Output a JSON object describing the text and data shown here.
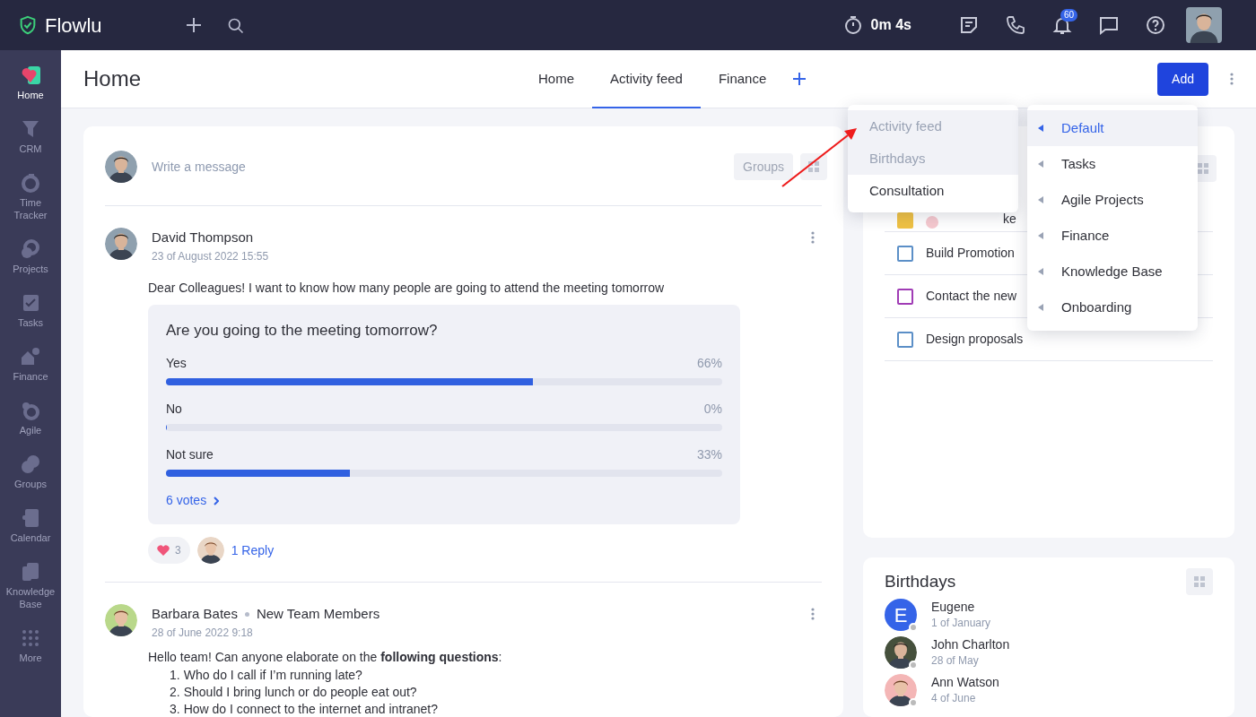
{
  "topbar": {
    "logo": "Flowlu",
    "timer": "0m 4s",
    "notifications_badge": "60"
  },
  "sidebar": {
    "items": [
      {
        "label": "Home",
        "selected": true
      },
      {
        "label": "CRM",
        "selected": false
      },
      {
        "label": "Time Tracker",
        "selected": false
      },
      {
        "label": "Projects",
        "selected": false
      },
      {
        "label": "Tasks",
        "selected": false
      },
      {
        "label": "Finance",
        "selected": false
      },
      {
        "label": "Agile",
        "selected": false
      },
      {
        "label": "Groups",
        "selected": false
      },
      {
        "label": "Calendar",
        "selected": false
      },
      {
        "label": "Knowledge Base",
        "selected": false
      },
      {
        "label": "More",
        "selected": false
      }
    ]
  },
  "header": {
    "title": "Home",
    "tabs": [
      {
        "label": "Home",
        "selected": false
      },
      {
        "label": "Activity feed",
        "selected": true
      },
      {
        "label": "Finance",
        "selected": false
      }
    ],
    "add_button": "Add"
  },
  "composer": {
    "placeholder": "Write a message",
    "groups_button": "Groups"
  },
  "posts": [
    {
      "author": "David Thompson",
      "date": "23 of August 2022 15:55",
      "text": "Dear Colleagues! I want to know how many people are going to attend the meeting tomorrow",
      "poll": {
        "question": "Are you going to the meeting tomorrow?",
        "options": [
          {
            "label": "Yes",
            "percent": "66%",
            "level": 0.66
          },
          {
            "label": "No",
            "percent": "0%",
            "level": 0
          },
          {
            "label": "Not sure",
            "percent": "33%",
            "level": 0.33
          }
        ],
        "votes": "6 votes"
      },
      "likes": "3",
      "replies": "1 Reply"
    },
    {
      "author": "Barbara Bates",
      "group": "New Team Members",
      "date": "28 of June 2022 9:18",
      "text": "Hello team! Can anyone elaborate on the **following questions**:",
      "list": [
        {
          "marker": "1.",
          "text": "Who do I call if I’m running late?"
        },
        {
          "marker": "2.",
          "text": "Should I bring lunch or do people eat out?"
        },
        {
          "marker": "3.",
          "text": "How do I connect to the internet and intranet?"
        }
      ]
    }
  ],
  "tasks": {
    "items": [
      {
        "text": "ke",
        "color": "#f0c244"
      },
      {
        "text": "Build Promotion",
        "color": "#5b8fc7"
      },
      {
        "text": "Contact the new",
        "color": "#a03cb5"
      },
      {
        "text": "Design proposals",
        "color": "#5b8fc7"
      }
    ]
  },
  "birthdays": {
    "title": "Birthdays",
    "people": [
      {
        "name": "Eugene",
        "date": "1 of January",
        "kind": "letter",
        "initial": "E"
      },
      {
        "name": "John Charlton",
        "date": "28 of May",
        "kind": "photo"
      },
      {
        "name": "Ann Watson",
        "date": "4 of June",
        "kind": "photo"
      }
    ]
  },
  "widget_menu": {
    "items": [
      {
        "label": "Activity feed",
        "disabled": true
      },
      {
        "label": "Birthdays",
        "disabled": true
      },
      {
        "label": "Consultation",
        "disabled": false
      }
    ]
  },
  "dashboard_menu": {
    "items": [
      {
        "label": "Default",
        "selected": true
      },
      {
        "label": "Tasks",
        "selected": false
      },
      {
        "label": "Agile Projects",
        "selected": false
      },
      {
        "label": "Finance",
        "selected": false
      },
      {
        "label": "Knowledge Base",
        "selected": false
      },
      {
        "label": "Onboarding",
        "selected": false
      }
    ]
  }
}
